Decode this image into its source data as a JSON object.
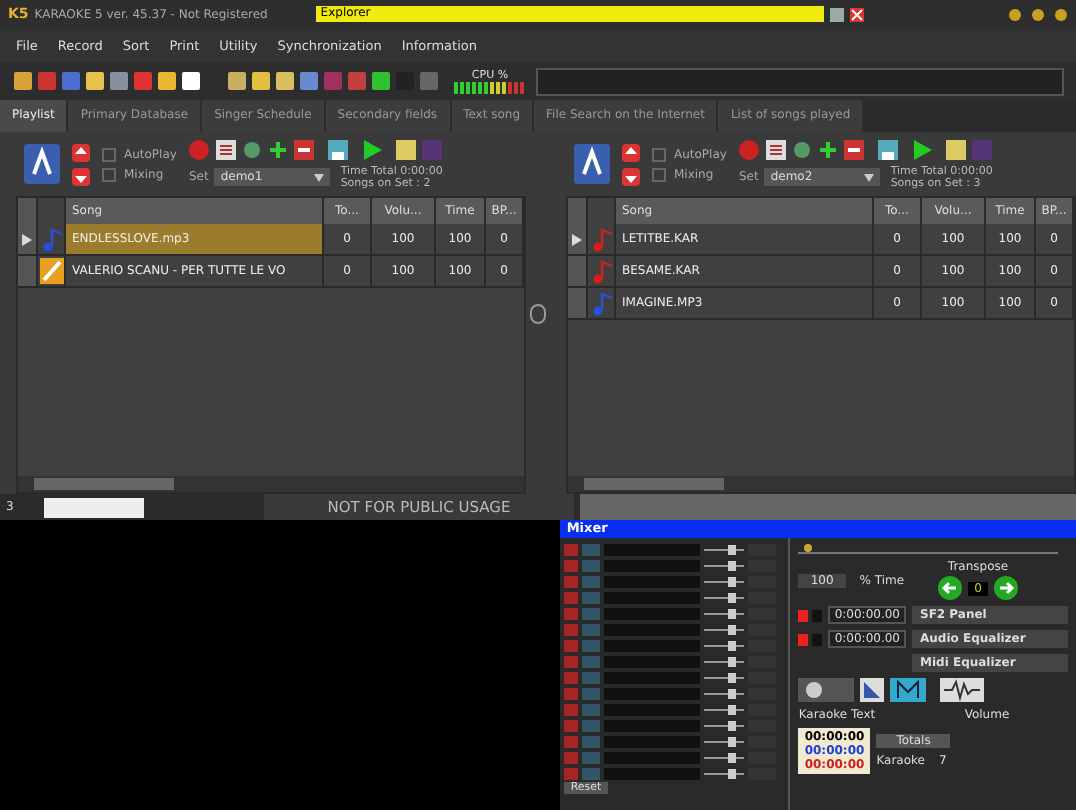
{
  "window": {
    "logo": "K5",
    "title": "KARAOKE 5  ver. 45.37 - Not Registered",
    "explorer": "Explorer"
  },
  "menu": [
    "File",
    "Record",
    "Sort",
    "Print",
    "Utility",
    "Synchronization",
    "Information"
  ],
  "cpu": {
    "label": "CPU %"
  },
  "tabs": [
    {
      "label": "Playlist",
      "selected": true
    },
    {
      "label": "Primary Database",
      "selected": false
    },
    {
      "label": "Singer Schedule",
      "selected": false
    },
    {
      "label": "Secondary fields",
      "selected": false
    },
    {
      "label": "Text song",
      "selected": false
    },
    {
      "label": "File Search on the Internet",
      "selected": false
    },
    {
      "label": "List of songs played",
      "selected": false
    }
  ],
  "playlists": [
    {
      "autoplay": {
        "label": "AutoPlay",
        "checked": false
      },
      "mixing": {
        "label": "Mixing",
        "checked": false
      },
      "set_label": "Set",
      "set": "demo1",
      "time_total": "Time Total  0:00:00",
      "songs_on_set": "Songs on Set : 2",
      "columns": [
        "Song",
        "To...",
        "Volu...",
        "Time",
        "BP..."
      ],
      "rows": [
        {
          "kind": "mp3",
          "current": true,
          "selected": true,
          "cells": [
            "ENDLESSLOVE.mp3",
            "0",
            "100",
            "100",
            "0"
          ]
        },
        {
          "kind": "video",
          "current": false,
          "selected": false,
          "cells": [
            "VALERIO SCANU - PER TUTTE LE VO",
            "0",
            "100",
            "100",
            "0"
          ]
        }
      ]
    },
    {
      "autoplay": {
        "label": "AutoPlay",
        "checked": false
      },
      "mixing": {
        "label": "Mixing",
        "checked": false
      },
      "set_label": "Set",
      "set": "demo2",
      "time_total": "Time Total  0:00:00",
      "songs_on_set": "Songs on Set : 3",
      "columns": [
        "Song",
        "To...",
        "Volu...",
        "Time",
        "BP..."
      ],
      "rows": [
        {
          "kind": "kar",
          "current": true,
          "selected": false,
          "cells": [
            "LETITBE.KAR",
            "0",
            "100",
            "100",
            "0"
          ]
        },
        {
          "kind": "kar",
          "current": false,
          "selected": false,
          "cells": [
            "BESAME.KAR",
            "0",
            "100",
            "100",
            "0"
          ]
        },
        {
          "kind": "mp3",
          "current": false,
          "selected": false,
          "cells": [
            "IMAGINE.MP3",
            "0",
            "100",
            "100",
            "0"
          ]
        }
      ]
    }
  ],
  "status": {
    "page": "3",
    "notice": "NOT FOR PUBLIC USAGE"
  },
  "mixer": {
    "title": "Mixer",
    "position": {
      "level": 0.02
    },
    "time_value": "100",
    "time_label": "% Time",
    "transpose_label": "Transpose",
    "transpose_value": "0",
    "positions": [
      "0:00:00.00",
      "0:00:00.00"
    ],
    "panels": [
      "SF2 Panel",
      "Audio Equalizer",
      "Midi Equalizer"
    ],
    "volume_label": "Volume",
    "karaoke_text_label": "Karaoke Text",
    "timers": [
      {
        "text": "00:00:00",
        "color": "#000000"
      },
      {
        "text": "00:00:00",
        "color": "#1f3fd0"
      },
      {
        "text": "00:00:00",
        "color": "#d01f1f"
      }
    ],
    "totals_label": "Totals",
    "totals": [
      {
        "label": "Karaoke",
        "value": "7"
      }
    ],
    "buttons": [
      "Reset"
    ]
  }
}
